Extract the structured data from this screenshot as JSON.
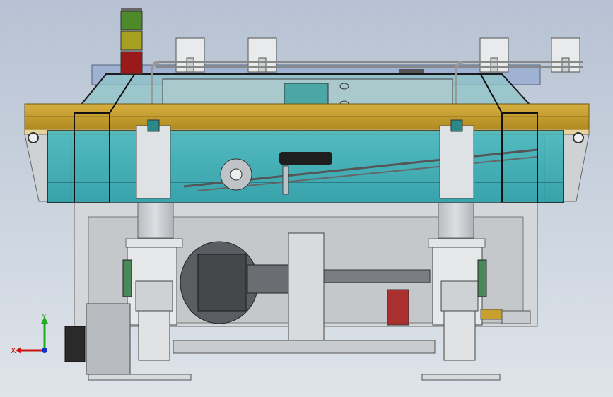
{
  "viewport": {
    "background_top": "#b6c2d3",
    "background_bottom": "#dfe4ea"
  },
  "model": {
    "frame_color": "#2aa8b0",
    "rail_color": "#c9a030",
    "housing_color": "#c8ccd0",
    "signal_tower": {
      "segments": [
        "green",
        "yellow",
        "red"
      ],
      "colors": [
        "#4f8a2a",
        "#a8a020",
        "#9a1a1a"
      ]
    }
  },
  "triad": {
    "x_label": "X",
    "y_label": "Y",
    "x_color": "#cc1111",
    "y_color": "#22aa22",
    "z_color": "#1133cc"
  }
}
